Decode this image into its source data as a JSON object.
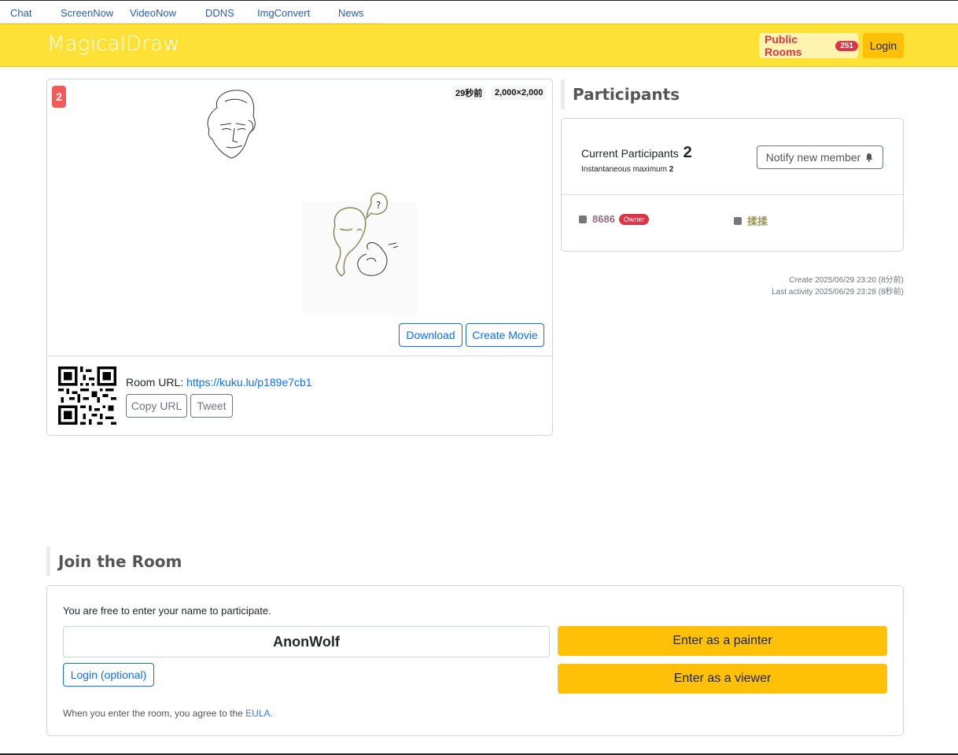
{
  "topnav": {
    "items": [
      "Chat",
      "ScreenNow",
      "VideoNow",
      "DDNS",
      "ImgConvert",
      "News"
    ]
  },
  "header": {
    "brand": "MagicalDraw",
    "public_rooms_label": "Public Rooms",
    "public_rooms_count": "251",
    "login_label": "Login"
  },
  "canvas": {
    "participant_badge": "2",
    "time_ago": "29秒前",
    "dimensions": "2,000×2,000",
    "download_label": "Download",
    "create_movie_label": "Create Movie",
    "room_url_label": "Room URL:",
    "room_url": "https://kuku.lu/p189e7cb1",
    "copy_url_label": "Copy URL",
    "tweet_label": "Tweet"
  },
  "participants": {
    "title": "Participants",
    "current_label": "Current Participants",
    "current_count": "2",
    "max_label": "Instantaneous maximum",
    "max_count": "2",
    "notify_label": "Notify new member",
    "members": [
      {
        "name": "8686",
        "badge": "Owner",
        "color": "#9a6a7a"
      },
      {
        "name": "揉揉",
        "badge": "",
        "color": "#9a9a5a"
      }
    ],
    "created": "Create 2025/06/29 23:20 (8分前)",
    "last_activity": "Last activity 2025/06/29 23:28 (8秒前)"
  },
  "join": {
    "title": "Join the Room",
    "intro": "You are free to enter your name to participate.",
    "name_value": "AnonWolf",
    "login_optional_label": "Login (optional)",
    "enter_painter_label": "Enter as a painter",
    "enter_viewer_label": "Enter as a viewer",
    "eula_prefix": "When you enter the room, you agree to the",
    "eula_link": "EULA",
    "eula_suffix": "."
  },
  "colors": {
    "header_bg": "#fde137",
    "accent_yellow": "#ffc107",
    "primary_blue": "#0d6efd",
    "danger_red": "#dc3545"
  }
}
